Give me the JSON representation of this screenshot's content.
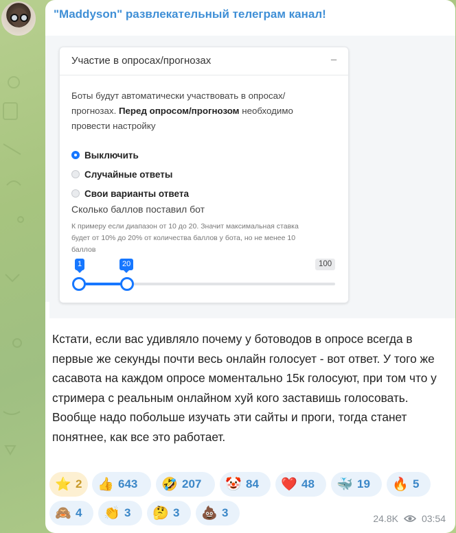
{
  "channel": {
    "name": "\"Maddyson\" развлекательный телеграм канал!"
  },
  "screenshot_card": {
    "title": "Участие в опросах/прогнозах",
    "collapse_icon": "−",
    "description_part1": "Боты будут автоматически участвовать в опросах/прогнозах. ",
    "description_bold": "Перед опросом/прогнозом",
    "description_part2": " необходимо провести настройку",
    "options": [
      {
        "label": "Выключить",
        "selected": true
      },
      {
        "label": "Случайные ответы",
        "selected": false
      },
      {
        "label": "Свои варианты ответа",
        "selected": false
      }
    ],
    "points_label": "Сколько баллов поставил бот",
    "points_hint": "К примеру если диапазон от 10 до 20. Значит максимальная ставка будет от 10% до 20% от количества баллов у бота, но не менее 10 баллов",
    "slider": {
      "min_value": "1",
      "max_value": "20",
      "range_max": "100",
      "accent": "#1677ff"
    }
  },
  "message": {
    "text": "Кстати, если вас удивляло почему у ботоводов в опросе всегда в первые же секунды почти весь онлайн голосует - вот ответ. У того же сасавота на каждом опросе моментально 15к голосуют, при том что у стримера с реальным онлайном хуй кого заставишь голосовать. Вообще надо побольше изучать эти сайты и проги, тогда станет понятнее, как все это работает."
  },
  "reactions": [
    {
      "emoji": "⭐",
      "icon": "star-icon",
      "count": "2"
    },
    {
      "emoji": "👍",
      "icon": "thumbs-up-icon",
      "count": "643"
    },
    {
      "emoji": "🤣",
      "icon": "rofl-icon",
      "count": "207"
    },
    {
      "emoji": "🤡",
      "icon": "clown-icon",
      "count": "84"
    },
    {
      "emoji": "❤️",
      "icon": "heart-icon",
      "count": "48"
    },
    {
      "emoji": "🐳",
      "icon": "whale-icon",
      "count": "19"
    },
    {
      "emoji": "🔥",
      "icon": "fire-icon",
      "count": "5"
    },
    {
      "emoji": "🙈",
      "icon": "see-no-evil-monkey-icon",
      "count": "4"
    },
    {
      "emoji": "👏",
      "icon": "clap-icon",
      "count": "3"
    },
    {
      "emoji": "🤔",
      "icon": "thinking-icon",
      "count": "3"
    },
    {
      "emoji": "💩",
      "icon": "poop-icon",
      "count": "3"
    }
  ],
  "meta": {
    "views": "24.8K",
    "time": "03:54"
  },
  "colors": {
    "link": "#3f8fd6",
    "reaction_text": "#3b87c8",
    "reaction_bg": "#e9f2fb"
  }
}
